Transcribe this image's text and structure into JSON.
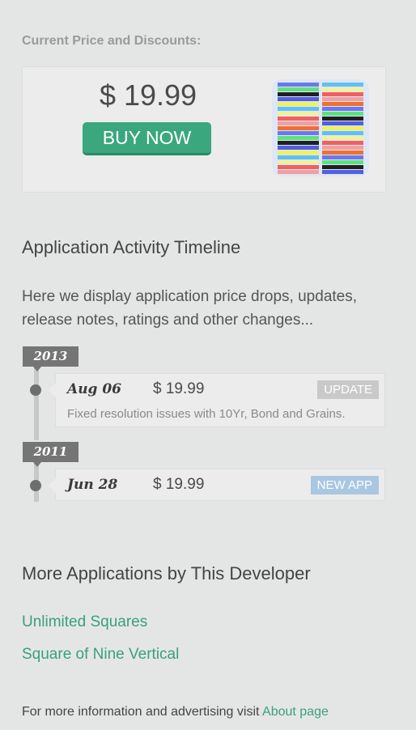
{
  "price_section": {
    "label": "Current Price and Discounts:",
    "price": "$ 19.99",
    "buy_label": "BUY NOW"
  },
  "timeline": {
    "heading": "Application Activity Timeline",
    "description": "Here we display application price drops, updates, release notes, ratings and other changes...",
    "years": [
      {
        "year": "2013",
        "entries": [
          {
            "date": "Aug 06",
            "price": "$ 19.99",
            "badge": "UPDATE",
            "badge_color": "#c9c9c9",
            "note": "Fixed resolution issues with 10Yr, Bond and Grains."
          }
        ]
      },
      {
        "year": "2011",
        "entries": [
          {
            "date": "Jun 28",
            "price": "$ 19.99",
            "badge": "NEW APP",
            "badge_color": "#a9c7e0"
          }
        ]
      }
    ]
  },
  "more_apps": {
    "heading": "More Applications by This Developer",
    "links": [
      "Unlimited Squares",
      "Square of Nine Vertical"
    ]
  },
  "footer": {
    "text": "For more information and advertising visit",
    "link_label": "About page"
  },
  "colors": {
    "accent": "#3aa77f",
    "link": "#3a9f7e",
    "background": "#e4e6e6"
  }
}
